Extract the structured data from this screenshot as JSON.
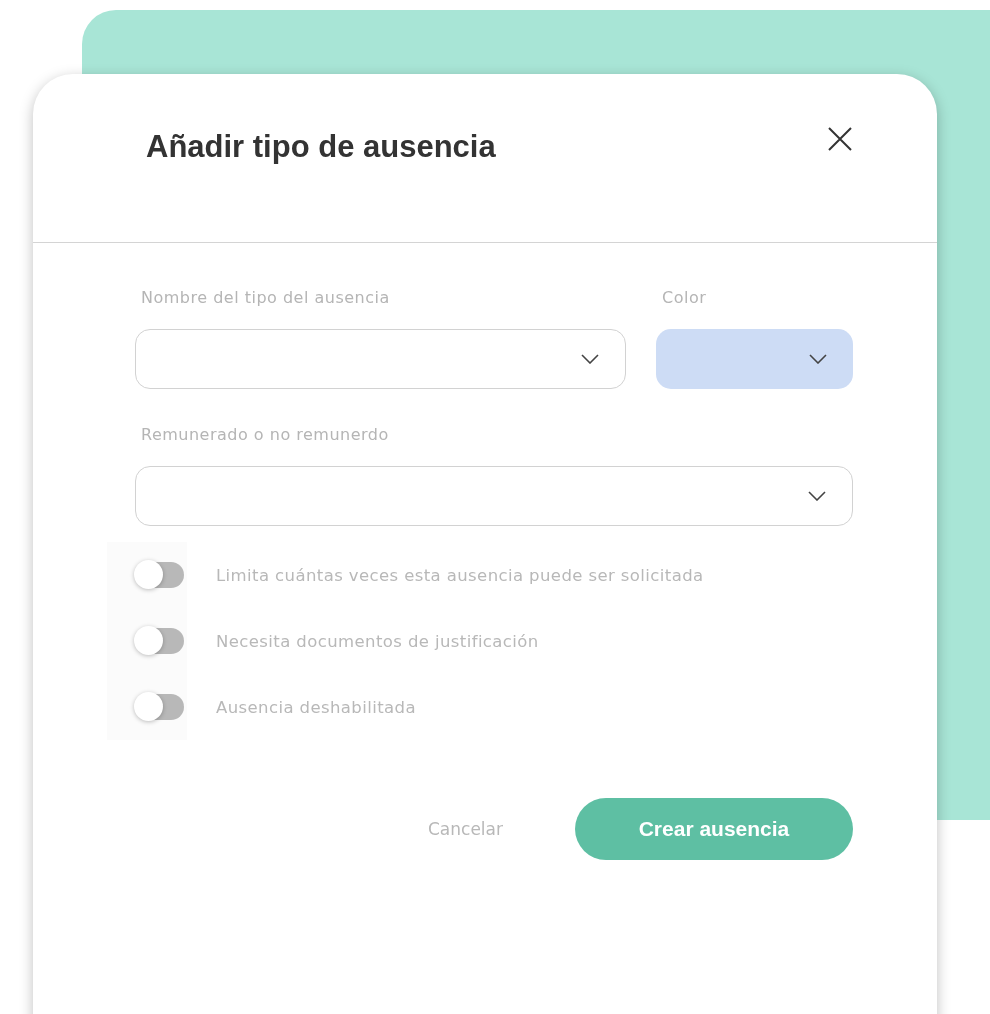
{
  "dialog": {
    "title": "Añadir tipo de ausencia"
  },
  "fields": [
    {
      "label": "Nombre del tipo del ausencia",
      "kind": "select"
    },
    {
      "label": "Color",
      "kind": "color",
      "color": "#cddcf5"
    },
    {
      "label": "Remunerado o no remunerdo",
      "kind": "select"
    }
  ],
  "toggles": [
    {
      "label": "Limita cuántas veces esta ausencia puede ser solicitada",
      "on": false
    },
    {
      "label": "Necesita documentos de justificación",
      "on": false
    },
    {
      "label": "Ausencia deshabilitada",
      "on": false
    }
  ],
  "buttons": [
    {
      "label": "Cancelar",
      "kind": "secondary"
    },
    {
      "label": "Crear ausencia",
      "kind": "primary"
    }
  ]
}
